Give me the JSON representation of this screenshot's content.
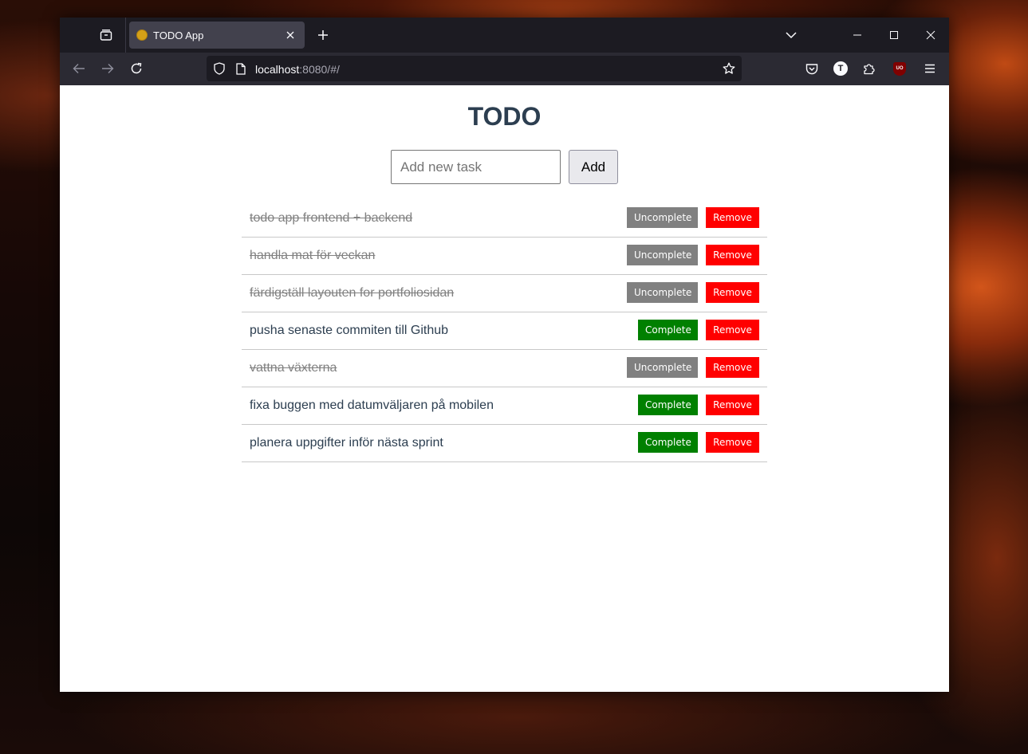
{
  "browser": {
    "tab_title": "TODO App",
    "url_host": "localhost",
    "url_rest": ":8080/#/",
    "profile_initial": "T",
    "ublock_label": "UO"
  },
  "app": {
    "title": "TODO",
    "input_placeholder": "Add new task",
    "add_label": "Add"
  },
  "tasks": [
    {
      "text": "todo app frontend + backend",
      "completed": true,
      "toggle_label": "Uncomplete",
      "remove_label": "Remove"
    },
    {
      "text": "handla mat för veckan",
      "completed": true,
      "toggle_label": "Uncomplete",
      "remove_label": "Remove"
    },
    {
      "text": "färdigställ layouten for portfoliosidan",
      "completed": true,
      "toggle_label": "Uncomplete",
      "remove_label": "Remove"
    },
    {
      "text": "pusha senaste commiten till Github",
      "completed": false,
      "toggle_label": "Complete",
      "remove_label": "Remove"
    },
    {
      "text": "vattna växterna",
      "completed": true,
      "toggle_label": "Uncomplete",
      "remove_label": "Remove"
    },
    {
      "text": "fixa buggen med datumväljaren på mobilen",
      "completed": false,
      "toggle_label": "Complete",
      "remove_label": "Remove"
    },
    {
      "text": "planera uppgifter inför nästa sprint",
      "completed": false,
      "toggle_label": "Complete",
      "remove_label": "Remove"
    }
  ]
}
